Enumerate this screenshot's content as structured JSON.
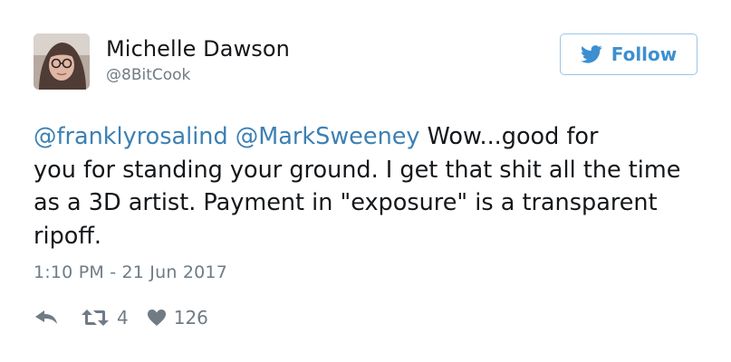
{
  "tweet": {
    "author": {
      "name": "Michelle Dawson",
      "handle": "@8BitCook"
    },
    "follow_label": "Follow",
    "mentions": [
      "@franklyrosalind",
      "@MarkSweeney"
    ],
    "text_line1_rest": " Wow...good for",
    "text_rest": "you for standing your ground. I get that shit all the time as a 3D artist. Payment in \"exposure\" is a transparent ripoff.",
    "timestamp": "1:10 PM - 21 Jun 2017",
    "retweet_count": "4",
    "like_count": "126"
  },
  "colors": {
    "link": "#3c80b3",
    "follow_accent": "#3d8fd0",
    "muted": "#707b84",
    "text": "#14171a"
  },
  "icons": {
    "reply": "reply-icon",
    "retweet": "retweet-icon",
    "like": "heart-icon",
    "follow": "twitter-bird-icon"
  }
}
